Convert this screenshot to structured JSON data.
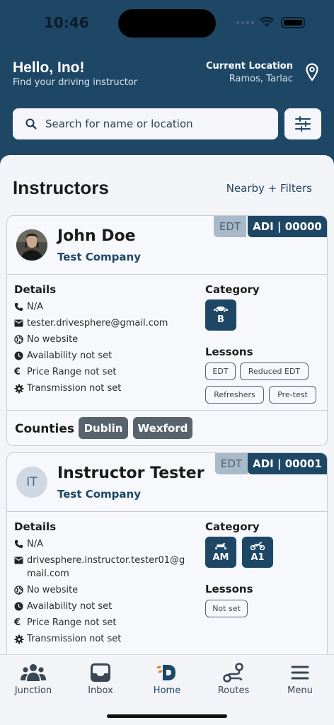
{
  "status_bar": {
    "time": "10:46"
  },
  "header": {
    "greeting": "Hello, Ino!",
    "subtitle": "Find your driving instructor",
    "location_title": "Current Location",
    "location_value": "Ramos, Tarlac"
  },
  "search": {
    "placeholder": "Search for name or location"
  },
  "main": {
    "title": "Instructors",
    "filter_link": "Nearby + Filters"
  },
  "instructors": [
    {
      "edt_badge": "EDT",
      "adi_badge": "ADI | 00000",
      "name": "John Doe",
      "company": "Test Company",
      "details_heading": "Details",
      "phone": "N/A",
      "email": "tester.drivesphere@gmail.com",
      "website": "No website",
      "availability": "Availability not set",
      "price": "Price Range not set",
      "transmission": "Transmission not set",
      "category_heading": "Category",
      "categories": [
        {
          "label": "B",
          "icon": "car-icon"
        }
      ],
      "lessons_heading": "Lessons",
      "lessons": [
        "EDT",
        "Reduced EDT",
        "Refreshers",
        "Pre-test"
      ],
      "counties_heading": "Counties",
      "counties": [
        "Dublin",
        "Wexford"
      ]
    },
    {
      "edt_badge": "EDT",
      "adi_badge": "ADI | 00001",
      "initials": "IT",
      "name": "Instructor Tester",
      "company": "Test Company",
      "details_heading": "Details",
      "phone": "N/A",
      "email": "drivesphere.instructor.tester01@gmail.com",
      "website": "No website",
      "availability": "Availability not set",
      "price": "Price Range not set",
      "transmission": "Transmission not set",
      "category_heading": "Category",
      "categories": [
        {
          "label": "AM",
          "icon": "scooter-icon"
        },
        {
          "label": "A1",
          "icon": "motorbike-icon"
        }
      ],
      "lessons_heading": "Lessons",
      "lessons": [
        "Not set"
      ]
    }
  ],
  "bottom_nav": [
    {
      "label": "Junction",
      "icon": "people-icon"
    },
    {
      "label": "Inbox",
      "icon": "inbox-icon"
    },
    {
      "label": "Home",
      "icon": "home-logo-icon",
      "active": true
    },
    {
      "label": "Routes",
      "icon": "route-icon"
    },
    {
      "label": "Menu",
      "icon": "hamburger-menu-icon"
    }
  ],
  "colors": {
    "primary": "#1e4766",
    "edt_badge_bg": "#a8bac9",
    "county_chip_bg": "#59636d",
    "sheet_bg": "#f3f4f8"
  }
}
